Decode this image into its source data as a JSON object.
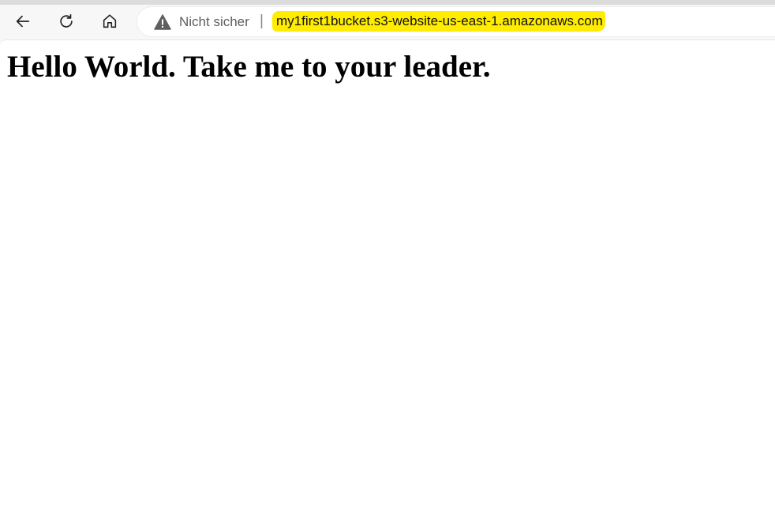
{
  "browser": {
    "security_label": "Nicht sicher",
    "separator": "|",
    "url": "my1first1bucket.s3-website-us-east-1.amazonaws.com",
    "url_highlight_color": "#ffec00",
    "icons": {
      "back": "back-arrow-icon",
      "reload": "reload-icon",
      "home": "home-icon",
      "security": "warning-triangle-icon"
    }
  },
  "page": {
    "heading": "Hello World. Take me to your leader."
  }
}
